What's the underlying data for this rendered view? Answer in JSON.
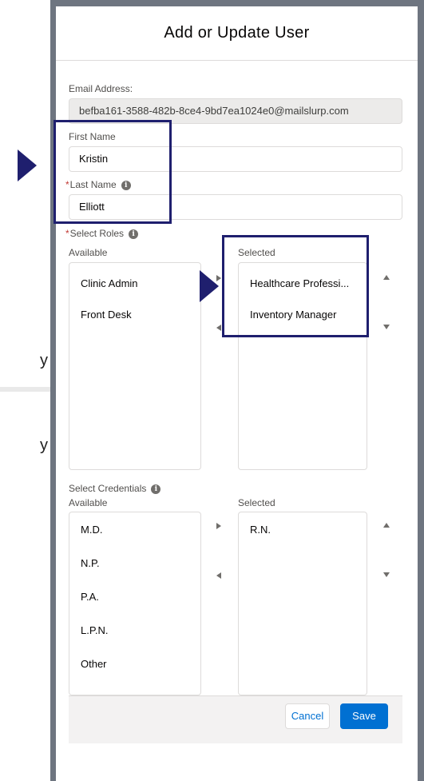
{
  "colors": {
    "highlight": "#1f1f6e",
    "primary_button": "#0070d2",
    "required_marker": "#c23934",
    "modal_frame": "#6e7580"
  },
  "modal": {
    "title": "Add or Update User"
  },
  "form": {
    "email_label": "Email Address:",
    "email_value": "befba161-3588-482b-8ce4-9bd7ea1024e0@mailslurp.com",
    "first_name_label": "First Name",
    "first_name_value": "Kristin",
    "last_name_label": "Last Name",
    "last_name_value": "Elliott",
    "required_marker": "*",
    "info_glyph": "i"
  },
  "roles": {
    "label": "Select Roles",
    "available_label": "Available",
    "selected_label": "Selected",
    "available": [
      "Clinic Admin",
      "Front Desk"
    ],
    "selected": [
      "Healthcare Professi...",
      "Inventory Manager"
    ]
  },
  "credentials": {
    "label": "Select Credentials",
    "available_label": "Available",
    "selected_label": "Selected",
    "available": [
      "M.D.",
      "N.P.",
      "P.A.",
      "L.P.N.",
      "Other"
    ],
    "selected": [
      "R.N."
    ]
  },
  "footer": {
    "cancel_label": "Cancel",
    "save_label": "Save"
  },
  "backdrop": {
    "glyph_1": "y",
    "glyph_2": "y"
  }
}
